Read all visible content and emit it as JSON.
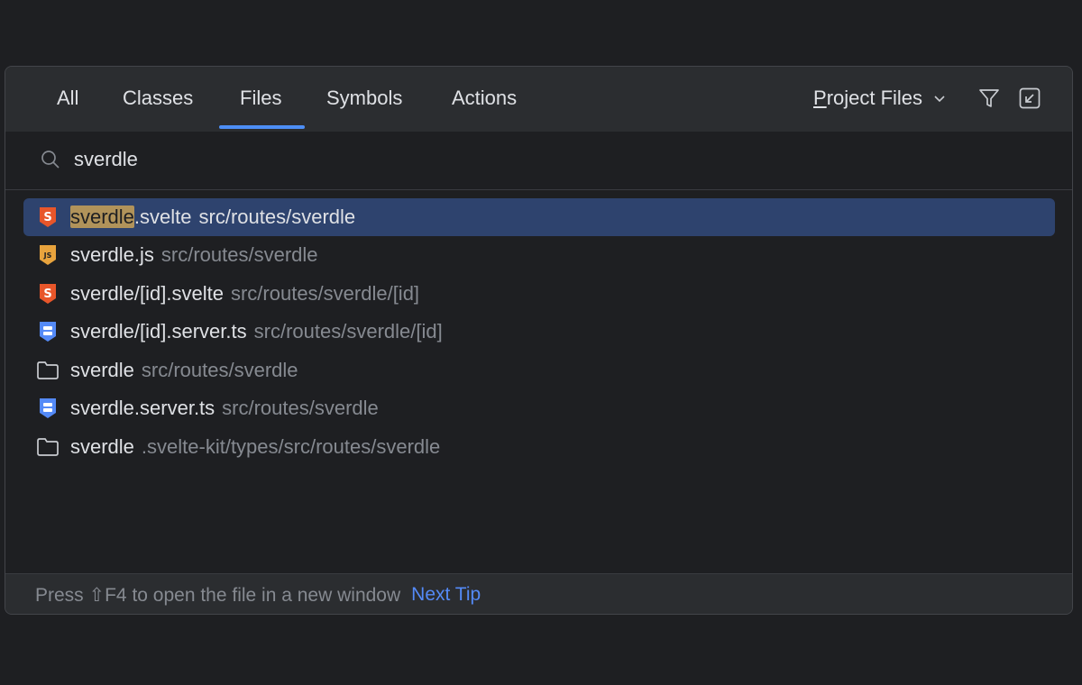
{
  "tabs": [
    {
      "label": "All"
    },
    {
      "label": "Classes"
    },
    {
      "label": "Files"
    },
    {
      "label": "Symbols"
    },
    {
      "label": "Actions"
    }
  ],
  "active_tab": "Files",
  "scope": {
    "mnemonic": "P",
    "rest": "roject Files"
  },
  "search": {
    "value": "sverdle"
  },
  "results": [
    {
      "icon": "svelte-file-icon",
      "match": "sverdle",
      "name_rest": ".svelte",
      "path": "src/routes/sverdle",
      "selected": true
    },
    {
      "icon": "js-file-icon",
      "name": "sverdle.js",
      "path": "src/routes/sverdle"
    },
    {
      "icon": "svelte-file-icon",
      "name": "sverdle/[id].svelte",
      "path": "src/routes/sverdle/[id]"
    },
    {
      "icon": "server-ts-file-icon",
      "name": "sverdle/[id].server.ts",
      "path": "src/routes/sverdle/[id]"
    },
    {
      "icon": "folder-icon",
      "name": "sverdle",
      "path": "src/routes/sverdle"
    },
    {
      "icon": "server-ts-file-icon",
      "name": "sverdle.server.ts",
      "path": "src/routes/sverdle"
    },
    {
      "icon": "folder-icon",
      "name": "sverdle",
      "path": ".svelte-kit/types/src/routes/sverdle"
    }
  ],
  "footer": {
    "tip": "Press ⇧F4 to open the file in a new window",
    "next_tip": "Next Tip"
  },
  "colors": {
    "accent": "#4d8ef5",
    "selection": "#2e436e",
    "highlight": "#b1935a",
    "svelte": "#e8562a",
    "js": "#e8a33d",
    "server": "#548af7"
  }
}
